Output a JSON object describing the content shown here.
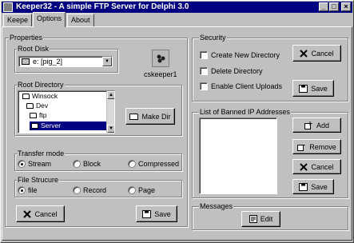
{
  "window": {
    "title": "Keeper32 - A simple FTP Server for Delphi 3.0"
  },
  "tabs": [
    {
      "label": "Keepe"
    },
    {
      "label": "Options"
    },
    {
      "label": "About"
    }
  ],
  "properties": {
    "label": "Properties",
    "root_disk": {
      "label": "Root Disk",
      "value": "e: [pig_2]"
    },
    "icon_caption": "cskeeper1",
    "root_directory": {
      "label": "Root Directory",
      "tree": [
        {
          "label": "Winsock"
        },
        {
          "label": "Dev"
        },
        {
          "label": "ftp"
        },
        {
          "label": "Server"
        }
      ]
    },
    "make_dir_label": "Make Dir",
    "transfer_mode": {
      "label": "Transfer mode",
      "options": [
        {
          "label": "Stream"
        },
        {
          "label": "Block"
        },
        {
          "label": "Compressed"
        }
      ],
      "selected": "Stream"
    },
    "file_structure": {
      "label": "File Strucure",
      "options": [
        {
          "label": "file"
        },
        {
          "label": "Record"
        },
        {
          "label": "Page"
        }
      ],
      "selected": "file"
    },
    "cancel_label": "Cancel",
    "save_label": "Save"
  },
  "security": {
    "label": "Security",
    "checks": [
      {
        "label": "Create New Directory"
      },
      {
        "label": "Delete Directory"
      },
      {
        "label": "Enable Client Uploads"
      }
    ],
    "cancel_label": "Cancel",
    "save_label": "Save"
  },
  "banned": {
    "label": "List of Banned IP Addresses",
    "add_label": "Add",
    "remove_label": "Remove",
    "cancel_label": "Cancel",
    "save_label": "Save"
  },
  "messages": {
    "label": "Messages",
    "edit_label": "Edit"
  },
  "colors": {
    "titlebar": "#000080",
    "face": "#c0c0c0",
    "selection": "#000080"
  }
}
